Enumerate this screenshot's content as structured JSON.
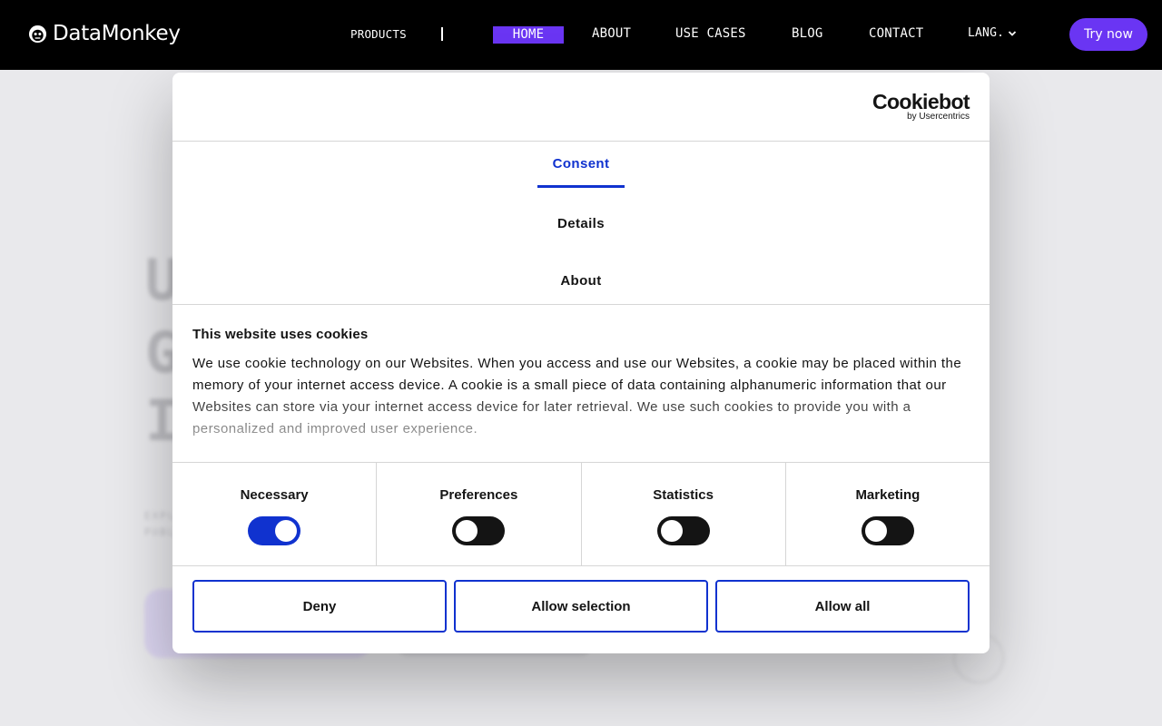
{
  "header": {
    "brand": "DataMonkey",
    "nav": {
      "products": "PRODUCTS",
      "home": "HOME",
      "about": "ABOUT",
      "use_cases": "USE CASES",
      "blog": "BLOG",
      "contact": "CONTACT",
      "lang": "LANG."
    },
    "cta": "Try now"
  },
  "dialog": {
    "brand": {
      "name": "Cookiebot",
      "tagline": "by Usercentrics"
    },
    "tabs": {
      "consent": "Consent",
      "details": "Details",
      "about": "About"
    },
    "content": {
      "title": "This website uses cookies",
      "body": "We use cookie technology on our Websites. When you access and use our Websites, a cookie may be placed within the memory of your internet access device. A cookie is a small piece of data containing alphanumeric information that our Websites can store via your internet access device for later retrieval. We use such cookies to provide you with a personalized and improved user experience."
    },
    "toggles": {
      "necessary": {
        "label": "Necessary",
        "checked": true
      },
      "preferences": {
        "label": "Preferences",
        "checked": false
      },
      "statistics": {
        "label": "Statistics",
        "checked": false
      },
      "marketing": {
        "label": "Marketing",
        "checked": false
      }
    },
    "buttons": {
      "deny": "Deny",
      "allow_selection": "Allow selection",
      "allow_all": "Allow all"
    }
  },
  "colors": {
    "accent_purple": "#6a35f3",
    "cookiebot_blue": "#1032cf",
    "header_bg": "#000000"
  },
  "icons": {
    "logo": "monkey-face-icon",
    "lang_chevron": "chevron-down-icon"
  }
}
